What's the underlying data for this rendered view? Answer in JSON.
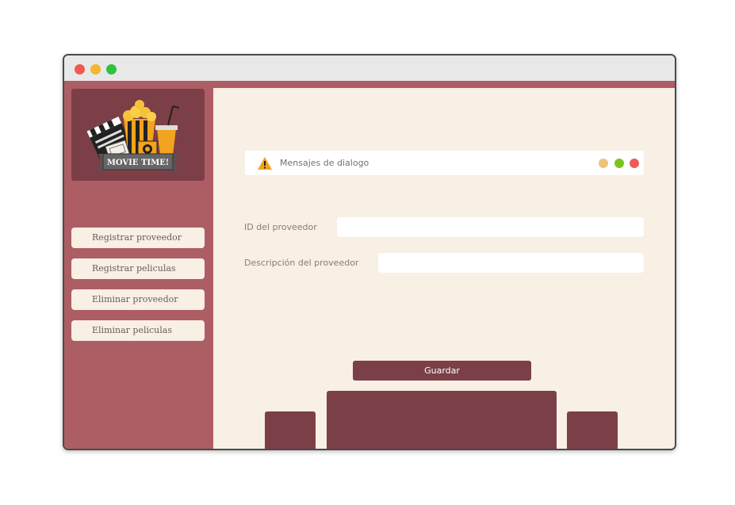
{
  "window": {
    "controls": [
      "close",
      "minimize",
      "maximize"
    ]
  },
  "sidebar": {
    "logo": {
      "text": "MOVIE TIME!"
    },
    "items": [
      {
        "label": "Registrar proveedor"
      },
      {
        "label": "Registrar peliculas"
      },
      {
        "label": "Eliminar proveedor"
      },
      {
        "label": "Eliminar peliculas"
      }
    ]
  },
  "dialog": {
    "icon": "warning-icon",
    "text": "Mensajes de dialogo",
    "dots": [
      "#ebc57a",
      "#7cc51f",
      "#ee5a5a"
    ]
  },
  "form": {
    "id_label": "ID del proveedor",
    "id_value": "",
    "desc_label": "Descripción del proveedor",
    "desc_value": ""
  },
  "actions": {
    "save_label": "Guardar"
  },
  "colors": {
    "accent": "#ad5e64",
    "dark": "#7b3f47",
    "background": "#f8efe5"
  }
}
